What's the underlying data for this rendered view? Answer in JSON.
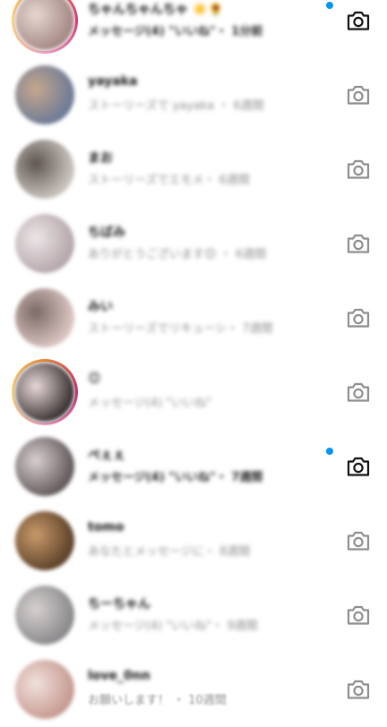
{
  "colors": {
    "unread_dot": "#0095f6",
    "camera_unread": "#111111",
    "camera_read": "#8e8e8e"
  },
  "icons": {
    "camera": "camera-icon",
    "unread": "unread-dot-icon"
  },
  "conversations": [
    {
      "name": "ちゃんちゃんちゃ ☀️🌻",
      "preview": "メッセージ(4) \"いいね\"・ 1分前",
      "unread": true,
      "story_ring": true,
      "avatar": [
        "#a58a86",
        "#e7d7d0"
      ]
    },
    {
      "name": "yayaka",
      "preview": "ストーリーズで yayaka ・ 6週間",
      "unread": false,
      "story_ring": false,
      "avatar": [
        "#6e7b97",
        "#c6a78d"
      ]
    },
    {
      "name": "まお",
      "preview": "ストーリーズでエモメ・ 6週間",
      "unread": false,
      "story_ring": false,
      "avatar": [
        "#c9c3be",
        "#5e5550"
      ]
    },
    {
      "name": "ちばみ",
      "preview": "ありがとうございます😊 ・ 6週間",
      "unread": false,
      "story_ring": false,
      "avatar": [
        "#b6a7ab",
        "#ece6e7"
      ]
    },
    {
      "name": "みい",
      "preview": "ストーリーズでリキューシ・ 7週間",
      "unread": false,
      "story_ring": false,
      "avatar": [
        "#d9c3c0",
        "#7b6a66"
      ]
    },
    {
      "name": "😊",
      "preview": "メッセージ(4) \"いいね\"",
      "unread": false,
      "story_ring": true,
      "avatar": [
        "#3d3535",
        "#e9d9d9"
      ]
    },
    {
      "name": "ぺぇぇ",
      "preview": "メッセージ(4) \"いいね\"・ 7週間",
      "unread": true,
      "story_ring": false,
      "avatar": [
        "#655b5c",
        "#d8cfd1"
      ]
    },
    {
      "name": "tomo",
      "preview": "あなたとメッセージに・ 8週間",
      "unread": false,
      "story_ring": false,
      "avatar": [
        "#5f432b",
        "#c89a6a"
      ]
    },
    {
      "name": "ちーちゃん",
      "preview": "メッセージ(4) \"いいね\"・ 9週間",
      "unread": false,
      "story_ring": false,
      "avatar": [
        "#8c8a8d",
        "#d6d1cf"
      ]
    },
    {
      "name": "love_0nn",
      "preview": "お願いします！ ・ 10週間",
      "unread": false,
      "story_ring": false,
      "avatar": [
        "#c79b92",
        "#f1e1dc"
      ]
    }
  ]
}
